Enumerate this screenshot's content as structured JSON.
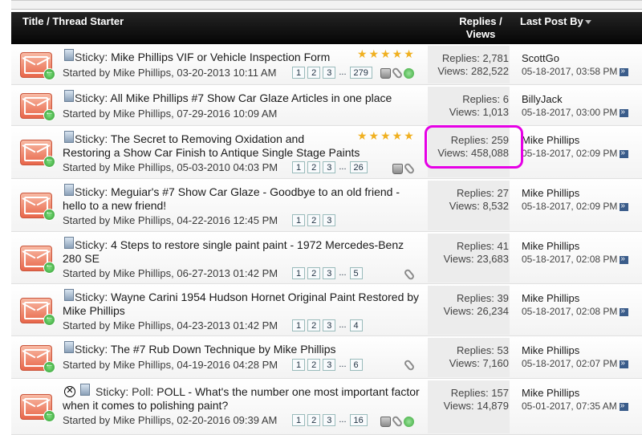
{
  "header": {
    "title_col": "Title / Thread Starter",
    "replies_col_line1": "Replies /",
    "replies_col_line2": "Views",
    "last_col": "Last Post By"
  },
  "threads": [
    {
      "prefix": "Sticky: ",
      "title1": "Mike Phillips VIF or Vehicle Inspection Form",
      "title2": "",
      "starter": "Started by Mike Phillips, 03-20-2013 10:11 AM",
      "pages": [
        "1",
        "2",
        "3",
        "...",
        "279"
      ],
      "stars": "★★★★★",
      "replies": "Replies: 2,781",
      "views": "Views: 282,522",
      "last_user": "ScottGo",
      "last_date": "05-18-2017, 03:58 PM"
    },
    {
      "prefix": "Sticky: ",
      "title1": "All Mike Phillips #7 Show Car Glaze Articles in one place",
      "title2": "",
      "starter": "Started by Mike Phillips, 07-29-2016 10:09 AM",
      "pages": [],
      "stars": "",
      "replies": "Replies: 6",
      "views": "Views: 1,013",
      "last_user": "BillyJack",
      "last_date": "05-18-2017, 03:00 PM"
    },
    {
      "prefix": "Sticky: ",
      "title1": "The Secret to Removing Oxidation and",
      "title2": "Restoring a Show Car Finish to Antique Single Stage Paints",
      "starter": "Started by Mike Phillips, 05-03-2010 04:03 PM",
      "pages": [
        "1",
        "2",
        "3",
        "...",
        "26"
      ],
      "stars": "★★★★★",
      "replies": "Replies: 259",
      "views": "Views: 458,088",
      "last_user": "Mike Phillips",
      "last_date": "05-18-2017, 02:09 PM"
    },
    {
      "prefix": "Sticky: ",
      "title1": "Meguiar's #7 Show Car Glaze - Goodbye to an old friend -",
      "title2": "hello to a new friend!",
      "starter": "Started by Mike Phillips, 04-22-2016 12:45 PM",
      "pages": [
        "1",
        "2",
        "3"
      ],
      "stars": "",
      "replies": "Replies: 27",
      "views": "Views: 8,532",
      "last_user": "Mike Phillips",
      "last_date": "05-18-2017, 02:09 PM"
    },
    {
      "prefix": "Sticky: ",
      "title1": "4 Steps to restore single paint paint - 1972 Mercedes-Benz",
      "title2": "280 SE",
      "starter": "Started by Mike Phillips, 06-27-2013 01:42 PM",
      "pages": [
        "1",
        "2",
        "3",
        "...",
        "5"
      ],
      "stars": "",
      "replies": "Replies: 41",
      "views": "Views: 23,683",
      "last_user": "Mike Phillips",
      "last_date": "05-18-2017, 02:08 PM"
    },
    {
      "prefix": "Sticky: ",
      "title1": "Wayne Carini 1954 Hudson Hornet Original Paint Restored by",
      "title2": "Mike Phillips",
      "starter": "Started by Mike Phillips, 04-23-2013 01:42 PM",
      "pages": [
        "1",
        "2",
        "3",
        "...",
        "4"
      ],
      "stars": "",
      "replies": "Replies: 39",
      "views": "Views: 26,234",
      "last_user": "Mike Phillips",
      "last_date": "05-18-2017, 02:08 PM"
    },
    {
      "prefix": "Sticky: ",
      "title1": "The #7 Rub Down Technique by Mike Phillips",
      "title2": "",
      "starter": "Started by Mike Phillips, 04-19-2016 04:28 PM",
      "pages": [
        "1",
        "2",
        "3",
        "...",
        "6"
      ],
      "stars": "",
      "replies": "Replies: 53",
      "views": "Views: 7,160",
      "last_user": "Mike Phillips",
      "last_date": "05-18-2017, 02:07 PM"
    },
    {
      "prefix": "Sticky: Poll: ",
      "title1": "POLL - What's the number one most important factor",
      "title2": "when it comes to polishing paint?",
      "starter": "Started by Mike Phillips, 02-20-2016 09:39 AM",
      "pages": [
        "1",
        "2",
        "3",
        "...",
        "16"
      ],
      "stars": "",
      "replies": "Replies: 157",
      "views": "Views: 14,879",
      "last_user": "Mike Phillips",
      "last_date": "05-01-2017, 07:35 AM"
    }
  ],
  "colors": {
    "header_bg": "#111111",
    "highlight": "#e600e6",
    "star": "#f0b020"
  }
}
